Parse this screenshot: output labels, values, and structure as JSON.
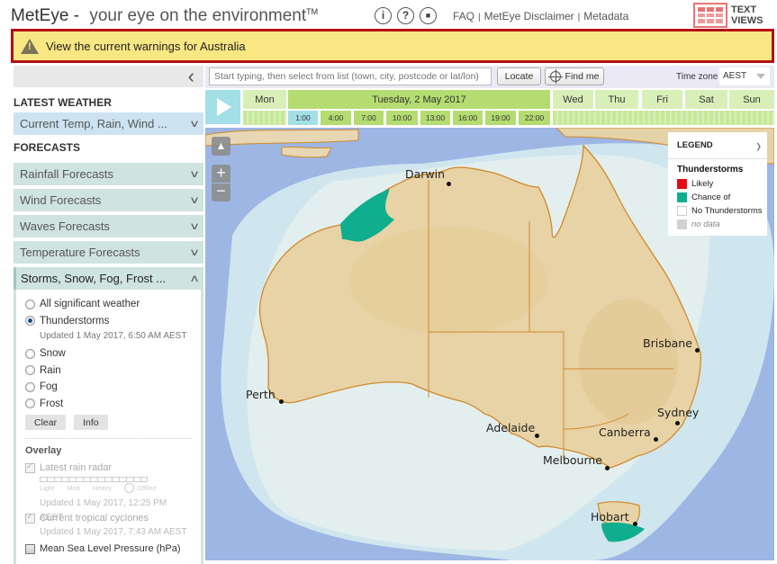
{
  "header": {
    "app_name": "MetEye",
    "dash": "-",
    "tagline": "your eye on the environment",
    "trademark": "TM",
    "icons": [
      "info-icon",
      "help-icon",
      "feedback-icon"
    ],
    "info_glyph": "i",
    "help_glyph": "?",
    "feedback_glyph": "■",
    "links": [
      "FAQ",
      "MetEye Disclaimer",
      "Metadata"
    ],
    "link_separator": "|",
    "text_views_line1": "TEXT",
    "text_views_line2": "VIEWS"
  },
  "warning": {
    "text": "View the current warnings for Australia",
    "colors": {
      "border": "#b30e16",
      "background": "#f9e784"
    }
  },
  "sidebar": {
    "collapse_glyph": "‹",
    "latest_heading": "LATEST WEATHER",
    "latest_item": "Current Temp, Rain, Wind ...",
    "forecasts_heading": "FORECASTS",
    "forecast_items": [
      "Rainfall Forecasts",
      "Wind Forecasts",
      "Waves Forecasts",
      "Temperature Forecasts"
    ],
    "open_item": "Storms, Snow, Fog, Frost ...",
    "chevron_down": "⌄",
    "chevron_up": "⌃",
    "options": [
      {
        "label": "All significant weather",
        "checked": false
      },
      {
        "label": "Thunderstorms",
        "checked": true
      },
      {
        "label": "Snow",
        "checked": false
      },
      {
        "label": "Rain",
        "checked": false
      },
      {
        "label": "Fog",
        "checked": false
      },
      {
        "label": "Frost",
        "checked": false
      }
    ],
    "thunderstorms_updated": "Updated 1 May 2017, 6:50 AM AEST",
    "clear_label": "Clear",
    "info_label": "Info",
    "overlay_heading": "Overlay",
    "overlay": {
      "radar_label": "Latest rain radar",
      "radar_scale": [
        "Light",
        "Mod",
        "Heavy"
      ],
      "radar_offline": "Offline",
      "radar_updated": "Updated 1 May 2017, 12:25 PM AEST",
      "cyclones_label": "Current tropical cyclones",
      "cyclones_updated": "Updated 1 May 2017, 7:43 AM AEST",
      "mslp_label": "Mean Sea Level Pressure (hPa)"
    }
  },
  "toolbar": {
    "search_placeholder": "Start typing, then select from list (town, city, postcode or lat/lon)",
    "locate_label": "Locate",
    "findme_label": "Find me",
    "timezone_label": "Time zone",
    "timezone_value": "AEST"
  },
  "timeline": {
    "days": [
      "Mon",
      "Tuesday, 2 May 2017",
      "Wed",
      "Thu",
      "Fri",
      "Sat",
      "Sun"
    ],
    "active_day": "Tuesday, 2 May 2017",
    "hours": [
      "1:00",
      "4:00",
      "7:00",
      "10:00",
      "13:00",
      "16:00",
      "19:00",
      "22:00"
    ],
    "current_hour": "1:00"
  },
  "map": {
    "zoom_in": "+",
    "zoom_out": "−",
    "home_glyph": "▲",
    "cities": [
      "Darwin",
      "Brisbane",
      "Perth",
      "Adelaide",
      "Sydney",
      "Canberra",
      "Melbourne",
      "Hobart"
    ]
  },
  "legend": {
    "title": "LEGEND",
    "toggle_glyph": "›",
    "subtitle": "Thunderstorms",
    "items": [
      {
        "label": "Likely",
        "color": "#e20b17"
      },
      {
        "label": "Chance of",
        "color": "#0fae8e"
      },
      {
        "label": "No Thunderstorms",
        "color": "#ffffff"
      },
      {
        "label": "no data",
        "color": "#d2d2d2"
      }
    ]
  }
}
